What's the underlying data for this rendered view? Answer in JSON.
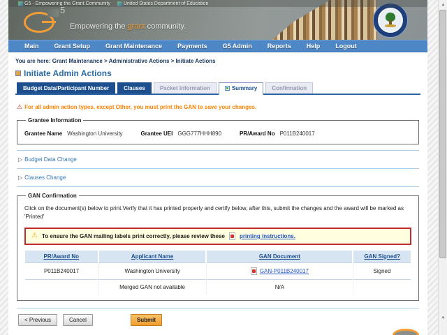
{
  "window": {
    "titles": [
      {
        "label": "G5 - Empowering the Grant Community"
      },
      {
        "label": "United States Department of Education"
      }
    ]
  },
  "banner": {
    "logo_five": "5",
    "tagline_pre": "Empowering the ",
    "tagline_highlight": "grant",
    "tagline_post": " community."
  },
  "nav": {
    "items": [
      "Main",
      "Grant Setup",
      "Grant Maintenance",
      "Payments",
      "G5 Admin",
      "Reports",
      "Help",
      "Logout"
    ]
  },
  "breadcrumb": {
    "prefix": "You are here:",
    "path": " Grant Maintenance > Administrative Actions > Initiate Actions"
  },
  "page": {
    "title": "Initiate Admin Actions"
  },
  "tabs": [
    {
      "label": "Budget Data/Participant Number",
      "state": "enabled"
    },
    {
      "label": "Clauses",
      "state": "enabled"
    },
    {
      "label": "Packet Information",
      "state": "disabled"
    },
    {
      "label": "Summary",
      "state": "current"
    },
    {
      "label": "Confirmation",
      "state": "disabled"
    }
  ],
  "warning": {
    "text": "For all admin action types, except Other, you must print the GAN to save your changes."
  },
  "grantee_info": {
    "legend": "Grantee Information",
    "fields": [
      {
        "label": "Grantee Name",
        "value": "Washington University"
      },
      {
        "label": "Grantee UEI",
        "value": "GGG777HHH890"
      },
      {
        "label": "PR/Award No",
        "value": "P011B240017"
      }
    ]
  },
  "sections": [
    {
      "label": "Budget Data Change"
    },
    {
      "label": "Clauses Change"
    }
  ],
  "gan": {
    "legend": "GAN Confirmation",
    "instructions": "Click on the document(s) below to print.Verify that it has printed properly and certify below, after this, submit the changes and the award will be marked as 'Printed'",
    "alert": {
      "text": "To ensure the GAN mailing labels print correctly, please review these",
      "link": "printing instructions."
    },
    "table": {
      "headers": [
        "PR/Award No",
        "Applicant Name",
        "GAN Document",
        "GAN Signed?"
      ],
      "rows": [
        {
          "award": "P011B240017",
          "applicant": "Washington University",
          "document": "GAN-P011B240017",
          "signed": "Signed"
        },
        {
          "award": "",
          "applicant": "Merged GAN not available",
          "document": "N/A",
          "signed": ""
        }
      ]
    }
  },
  "actions": {
    "previous": "< Previous",
    "cancel": "Cancel",
    "submit": "Submit"
  },
  "icons": {
    "warning_triangle": "⚠",
    "collapsed_arrow": "▷",
    "scroll_up": "▲",
    "scroll_down": "▼"
  },
  "colors": {
    "nav_blue": "#4e87c6",
    "tab_navy": "#1d4f8f",
    "warning_orange": "#ff8000",
    "alert_bg": "#fffede",
    "alert_border": "#c02b2b",
    "submit_orange": "#ef9d2e",
    "link_blue": "#2255cc",
    "table_header_bg": "#d7e4f2",
    "logo_orange": "#f49d37"
  }
}
